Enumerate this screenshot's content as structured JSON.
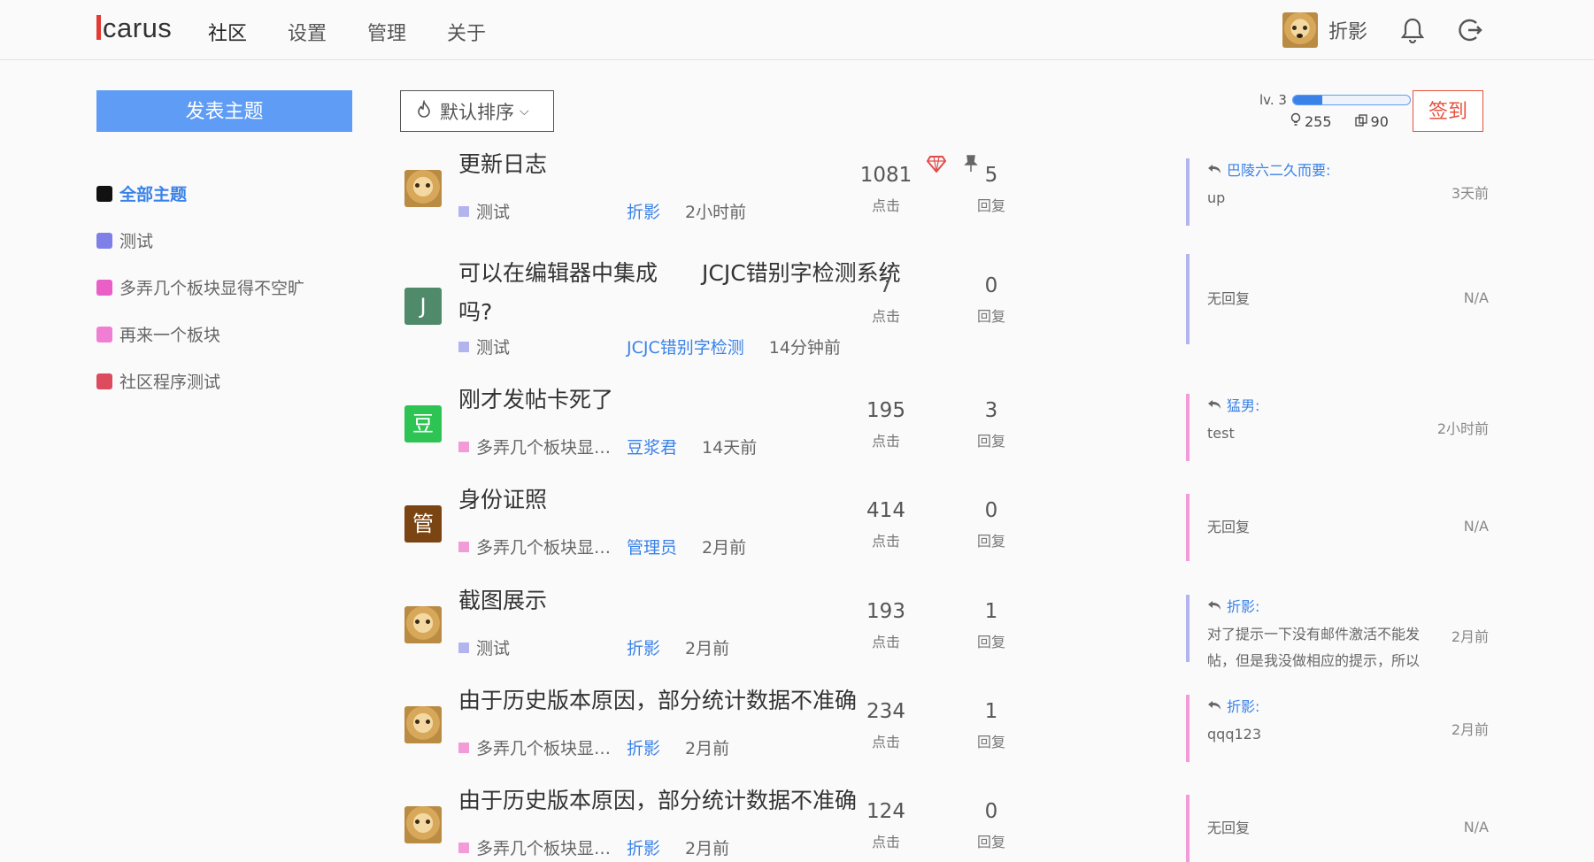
{
  "header": {
    "logo_rest": "carus",
    "nav": [
      "社区",
      "设置",
      "管理",
      "关于"
    ],
    "user_name": "折影"
  },
  "sidebar": {
    "post_button": "发表主题",
    "boards": [
      {
        "label": "全部主题",
        "color": "#111111"
      },
      {
        "label": "测试",
        "color": "#7f7fe8"
      },
      {
        "label": "多弄几个板块显得不空旷",
        "color": "#e95fc5"
      },
      {
        "label": "再来一个板块",
        "color": "#f07fd4"
      },
      {
        "label": "社区程序测试",
        "color": "#dc4b5e"
      }
    ]
  },
  "toolbar": {
    "sort_label": "默认排序"
  },
  "level": {
    "label": "lv. 3",
    "progress": 0.25,
    "points": "255",
    "coins": "90",
    "checkin": "签到"
  },
  "labels": {
    "clicks": "点击",
    "replies": "回复",
    "no_reply": "无回复"
  },
  "topics": [
    {
      "title": "更新日志",
      "title2": "",
      "board": "测试",
      "board_color": "#b3b3ef",
      "author": "折影",
      "time": "2小时前",
      "clicks": "1081",
      "replies": "5",
      "avatar": "doge",
      "avatar_text": "",
      "reply_user": "巴陵六二久而要:",
      "reply_text": "up",
      "reply_time": "3天前",
      "has_reply": true,
      "bar_color": "#b3b3ef"
    },
    {
      "title": "可以在编辑器中集成　　JCJC错别字检测系统",
      "title2": "吗?",
      "board": "测试",
      "board_color": "#b3b3ef",
      "author": "JCJC错别字检测",
      "time": "14分钟前",
      "clicks": "7",
      "replies": "0",
      "avatar": "letter",
      "avatar_text": "J",
      "avatar_color": "#4f8a6b",
      "reply_user": "",
      "reply_text": "无回复",
      "reply_time": "N/A",
      "has_reply": false,
      "bar_color": "#b3b3ef"
    },
    {
      "title": "刚才发帖卡死了",
      "title2": "",
      "board": "多弄几个板块显得...",
      "board_color": "#f39ad8",
      "author": "豆浆君",
      "time": "14天前",
      "clicks": "195",
      "replies": "3",
      "avatar": "letter",
      "avatar_text": "豆",
      "avatar_color": "#2ec454",
      "reply_user": "猛男:",
      "reply_text": "test",
      "reply_time": "2小时前",
      "has_reply": true,
      "bar_color": "#f39ad8"
    },
    {
      "title": "身份证照",
      "title2": "",
      "board": "多弄几个板块显得...",
      "board_color": "#f39ad8",
      "author": "管理员",
      "time": "2月前",
      "clicks": "414",
      "replies": "0",
      "avatar": "letter",
      "avatar_text": "管",
      "avatar_color": "#7a4413",
      "reply_user": "",
      "reply_text": "无回复",
      "reply_time": "N/A",
      "has_reply": false,
      "bar_color": "#f39ad8"
    },
    {
      "title": "截图展示",
      "title2": "",
      "board": "测试",
      "board_color": "#b3b3ef",
      "author": "折影",
      "time": "2月前",
      "clicks": "193",
      "replies": "1",
      "avatar": "doge",
      "avatar_text": "",
      "reply_user": "折影:",
      "reply_text": "对了提示一下没有邮件激活不能发帖，但是我没做相应的提示，所以",
      "reply_time": "2月前",
      "has_reply": true,
      "bar_color": "#b3b3ef"
    },
    {
      "title": "由于历史版本原因，部分统计数据不准确",
      "title2": "",
      "board": "多弄几个板块显得...",
      "board_color": "#f39ad8",
      "author": "折影",
      "time": "2月前",
      "clicks": "234",
      "replies": "1",
      "avatar": "doge",
      "avatar_text": "",
      "reply_user": "折影:",
      "reply_text": "qqq123",
      "reply_time": "2月前",
      "has_reply": true,
      "bar_color": "#f39ad8"
    },
    {
      "title": "由于历史版本原因，部分统计数据不准确",
      "title2": "",
      "board": "多弄几个板块显得...",
      "board_color": "#f39ad8",
      "author": "折影",
      "time": "2月前",
      "clicks": "124",
      "replies": "0",
      "avatar": "doge",
      "avatar_text": "",
      "reply_user": "",
      "reply_text": "无回复",
      "reply_time": "N/A",
      "has_reply": false,
      "bar_color": "#f39ad8"
    }
  ]
}
